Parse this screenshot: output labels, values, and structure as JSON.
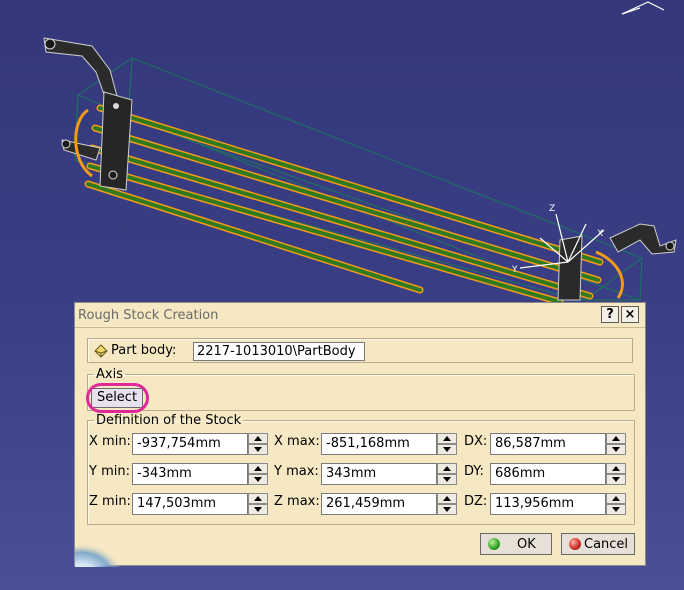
{
  "dialog": {
    "title": "Rough Stock Creation",
    "help_label": "?",
    "close_label": "×",
    "part_body_label": "Part body:",
    "part_body_value": "2217-1013010\\PartBody",
    "axis_legend": "Axis",
    "select_label": "Select",
    "definition_legend": "Definition of the Stock",
    "fields": {
      "x_min_label": "X min:",
      "x_min_value": "-937,754mm",
      "x_max_label": "X max:",
      "x_max_value": "-851,168mm",
      "dx_label": "DX:",
      "dx_value": "86,587mm",
      "y_min_label": "Y min:",
      "y_min_value": "-343mm",
      "y_max_label": "Y max:",
      "y_max_value": "343mm",
      "dy_label": "DY:",
      "dy_value": "686mm",
      "z_min_label": "Z min:",
      "z_min_value": "147,503mm",
      "z_max_label": "Z max:",
      "z_max_value": "261,459mm",
      "dz_label": "DZ:",
      "dz_value": "113,956mm"
    },
    "ok_label": "OK",
    "cancel_label": "Cancel"
  },
  "viewport": {
    "axis_z_label": "Z",
    "axis_y_label": "Y",
    "axis_x_label": "X"
  },
  "colors": {
    "background": "#363a7a",
    "dialog_bg": "#f6e8c3",
    "highlight_ring": "#e0289a",
    "tube_green": "#2f7a1e",
    "tube_orange": "#f29a1a"
  }
}
